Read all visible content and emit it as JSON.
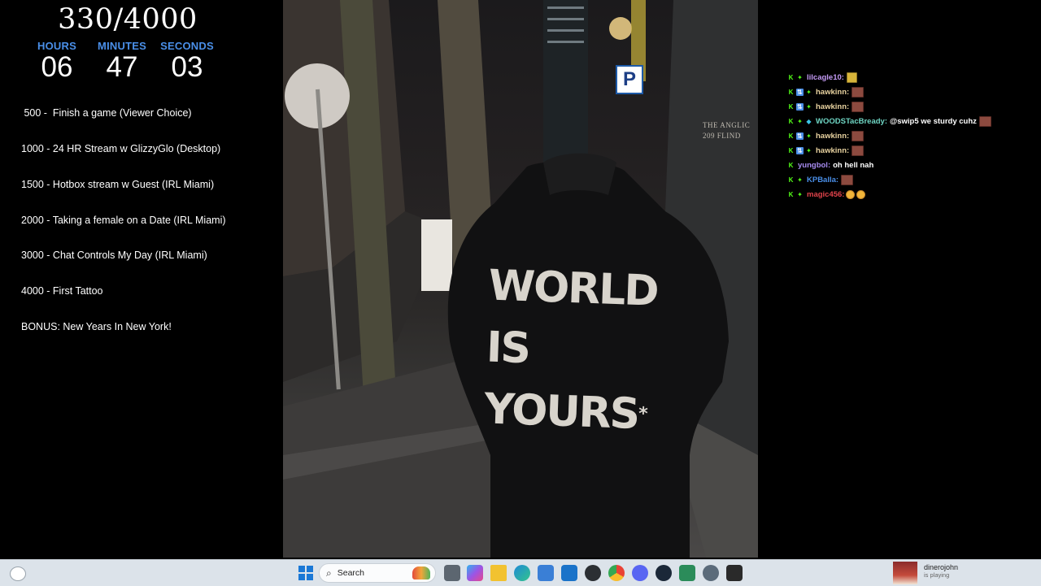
{
  "goal": {
    "count": "330/4000",
    "timer": {
      "labels": [
        "HOURS",
        "MINUTES",
        "SECONDS"
      ],
      "values": [
        "06",
        "47",
        "03"
      ]
    },
    "milestones": [
      " 500 -  Finish a game (Viewer Choice)",
      "1000 - 24 HR Stream w GlizzyGlo (Desktop)",
      "1500 - Hotbox stream w Guest (IRL Miami)",
      "2000 - Taking a female on a Date (IRL Miami)",
      "3000 - Chat Controls My Day (IRL Miami)",
      "4000 - First Tattoo",
      "BONUS: New Years In New York!"
    ]
  },
  "video": {
    "hoodie_lines": [
      "WORLD",
      "IS",
      "YOURS"
    ],
    "hoodie_asterisk": "*",
    "parking_sign": "P",
    "building_sign": [
      "THE ANGLIC",
      "209 FLIND"
    ]
  },
  "chat": {
    "messages": [
      {
        "user": "lilcagle10:",
        "color": "#c49af5",
        "badges": [
          "k",
          "spark"
        ],
        "text": "",
        "emotes": [
          "gold"
        ]
      },
      {
        "user": "hawkinn:",
        "color": "#e9d3a0",
        "badges": [
          "k",
          "blue",
          "spark"
        ],
        "text": "",
        "emotes": [
          "brick"
        ]
      },
      {
        "user": "hawkinn:",
        "color": "#e9d3a0",
        "badges": [
          "k",
          "blue",
          "spark"
        ],
        "text": "",
        "emotes": [
          "brick"
        ]
      },
      {
        "user": "WOODSTacBready:",
        "color": "#6fd6c4",
        "badges": [
          "k",
          "spark",
          "gem"
        ],
        "text": "@swip5 we sturdy cuhz",
        "emotes": [
          "brick"
        ]
      },
      {
        "user": "hawkinn:",
        "color": "#e9d3a0",
        "badges": [
          "k",
          "blue",
          "spark"
        ],
        "text": "",
        "emotes": [
          "brick"
        ]
      },
      {
        "user": "hawkinn:",
        "color": "#e9d3a0",
        "badges": [
          "k",
          "blue",
          "spark"
        ],
        "text": "",
        "emotes": [
          "brick"
        ]
      },
      {
        "user": "yungbol:",
        "color": "#a78bf0",
        "badges": [
          "k"
        ],
        "text": "oh hell nah",
        "emotes": []
      },
      {
        "user": "KPBalla:",
        "color": "#4a8fe8",
        "badges": [
          "k",
          "spark"
        ],
        "text": "",
        "emotes": [
          "brick"
        ]
      },
      {
        "user": "magic456:",
        "color": "#e0434b",
        "badges": [
          "k",
          "spark"
        ],
        "text": "",
        "emotes": [
          "face",
          "face"
        ]
      }
    ]
  },
  "taskbar": {
    "search_placeholder": "Search",
    "user_name": "dinerojohn",
    "user_status": "is playing"
  },
  "icons": {
    "badge_k": "K",
    "badge_spark": "✦",
    "badge_blue": "⇅",
    "badge_gem": "◆",
    "search_glyph": "⌕"
  }
}
